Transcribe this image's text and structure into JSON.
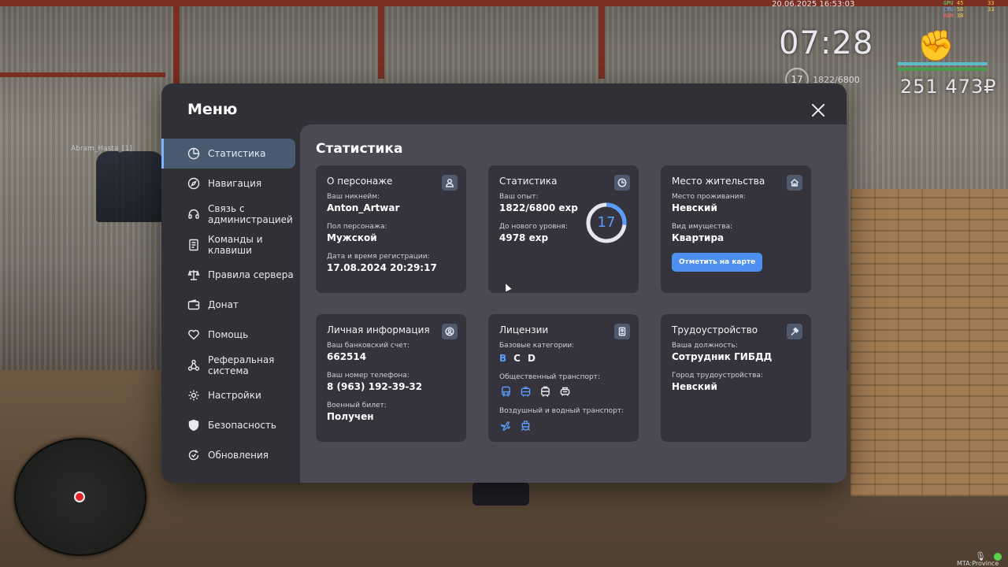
{
  "hud": {
    "date": "20.06.2025 16:53:03",
    "fps_labels": [
      "GPU",
      "CPU",
      "RAM"
    ],
    "fps_values": [
      "45",
      "56",
      "38"
    ],
    "fps_right": [
      "33",
      "33"
    ],
    "clock": "07:28",
    "level": "17",
    "exp": "1822/6800",
    "money": "251 473₽",
    "health_color": "#5bbcc8",
    "armor_color": "#4a9a4e",
    "mta_label": "MTA:Province"
  },
  "scene": {
    "nick_tag": "Abram_Hasta_[1]"
  },
  "menu": {
    "title": "Меню",
    "close_icon": "close-icon",
    "nav": [
      {
        "label": "Статистика",
        "icon": "pie-chart-icon",
        "active": true
      },
      {
        "label": "Навигация",
        "icon": "compass-icon",
        "active": false
      },
      {
        "label": "Связь с администрацией",
        "icon": "headset-icon",
        "active": false
      },
      {
        "label": "Команды и клавиши",
        "icon": "document-icon",
        "active": false
      },
      {
        "label": "Правила сервера",
        "icon": "scales-icon",
        "active": false
      },
      {
        "label": "Донат",
        "icon": "wallet-icon",
        "active": false
      },
      {
        "label": "Помощь",
        "icon": "heart-hands-icon",
        "active": false
      },
      {
        "label": "Реферальная система",
        "icon": "network-icon",
        "active": false
      },
      {
        "label": "Настройки",
        "icon": "gear-icon",
        "active": false
      },
      {
        "label": "Безопасность",
        "icon": "shield-icon",
        "active": false
      },
      {
        "label": "Обновления",
        "icon": "refresh-check-icon",
        "active": false
      }
    ]
  },
  "content": {
    "title": "Статистика",
    "character": {
      "title": "О персонаже",
      "icon": "user-icon",
      "nickname_label": "Ваш никнейм:",
      "nickname": "Anton_Artwar",
      "gender_label": "Пол персонажа:",
      "gender": "Мужской",
      "reg_label": "Дата и время регистрации:",
      "reg_value": "17.08.2024 20:29:17"
    },
    "stats": {
      "title": "Статистика",
      "icon": "clock-chart-icon",
      "exp_label": "Ваш опыт:",
      "exp_value": "1822/6800 exp",
      "next_label": "До нового уровня:",
      "next_value": "4978 exp",
      "level": "17",
      "progress": 0.268,
      "ring_color": "#5b9dff",
      "ring_track": "#e6e6ee"
    },
    "residence": {
      "title": "Место жительства",
      "icon": "house-icon",
      "place_label": "Место проживания:",
      "place": "Невский",
      "type_label": "Вид имущества:",
      "type": "Квартира",
      "button": "Отметить на карте"
    },
    "personal": {
      "title": "Личная информация",
      "icon": "user-circle-icon",
      "bank_label": "Ваш банковский счет:",
      "bank": "662514",
      "phone_label": "Ваш номер телефона:",
      "phone": "8 (963) 192-39-32",
      "military_label": "Военный билет:",
      "military": "Получен"
    },
    "licenses": {
      "title": "Лицензии",
      "icon": "id-card-icon",
      "base_label": "Базовые категории:",
      "categories": [
        {
          "name": "B",
          "active": true
        },
        {
          "name": "C",
          "active": false
        },
        {
          "name": "D",
          "active": false
        }
      ],
      "public_label": "Общественный транспорт:",
      "public": [
        {
          "icon": "bus-icon",
          "active": true
        },
        {
          "icon": "trolleybus-icon",
          "active": true
        },
        {
          "icon": "tram-icon",
          "active": false
        },
        {
          "icon": "taxi-icon",
          "active": false
        }
      ],
      "air_label": "Воздушный и водный транспорт:",
      "air": [
        {
          "icon": "plane-icon",
          "active": true
        },
        {
          "icon": "ship-icon",
          "active": true
        }
      ]
    },
    "employment": {
      "title": "Трудоустройство",
      "icon": "hammer-icon",
      "position_label": "Ваша должность:",
      "position": "Сотрудник ГИБДД",
      "city_label": "Город трудоустройства:",
      "city": "Невский"
    }
  }
}
